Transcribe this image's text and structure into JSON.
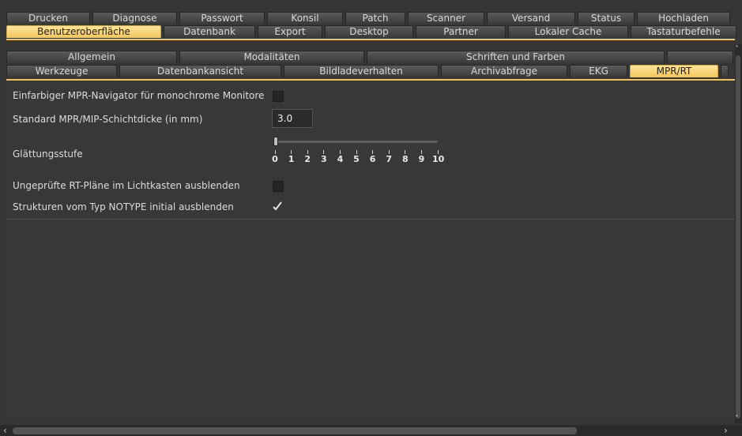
{
  "tabs_outer": {
    "row1": [
      "Drucken",
      "Diagnose",
      "Passwort",
      "Konsil",
      "Patch",
      "Scanner",
      "Versand",
      "Status",
      "Hochladen"
    ],
    "row2": [
      "Benutzeroberfläche",
      "Datenbank",
      "Export",
      "Desktop",
      "Partner",
      "Lokaler Cache",
      "Tastaturbefehle"
    ],
    "active": "Benutzeroberfläche"
  },
  "tabs_inner": {
    "row1": [
      "Allgemein",
      "Modalitäten",
      "Schriften und Farben",
      ""
    ],
    "row2": [
      "Werkzeuge",
      "Datenbankansicht",
      "Bildladeverhalten",
      "Archivabfrage",
      "EKG",
      "MPR/RT",
      ""
    ],
    "active": "MPR/RT"
  },
  "settings": {
    "mono_nav_label": "Einfarbiger MPR-Navigator für monochrome Monitore",
    "mono_nav_checked": false,
    "thickness_label": "Standard MPR/MIP-Schichtdicke (in mm)",
    "thickness_value": "3.0",
    "smoothing_label": "Glättungsstufe",
    "smoothing_value": 0,
    "smoothing_ticks": [
      "0",
      "1",
      "2",
      "3",
      "4",
      "5",
      "6",
      "7",
      "8",
      "9",
      "10"
    ],
    "hide_rt_label": "Ungeprüfte RT-Pläne im Lichtkasten ausblenden",
    "hide_rt_checked": false,
    "hide_notype_label": "Strukturen vom Typ NOTYPE initial ausblenden",
    "hide_notype_checked": true
  },
  "scroll": {
    "left_arrow": "‹",
    "right_arrow": "›",
    "up_arrow": "˄",
    "down_arrow": "˅"
  },
  "colors": {
    "active_tab": "#f3c55a",
    "background": "#363636"
  }
}
